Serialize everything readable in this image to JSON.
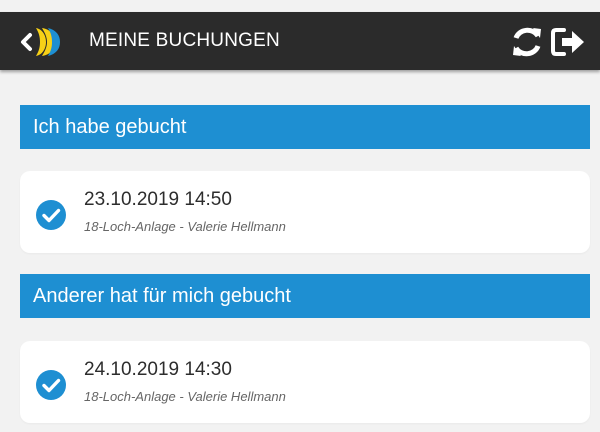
{
  "header": {
    "title": "MEINE BUCHUNGEN",
    "back_icon": "chevron-left-icon",
    "logo": "club-logo",
    "refresh_icon": "refresh-icon",
    "logout_icon": "sign-out-icon"
  },
  "sections": [
    {
      "title": "Ich habe gebucht",
      "bookings": [
        {
          "datetime": "23.10.2019 14:50",
          "detail": "18-Loch-Anlage - Valerie Hellmann",
          "status_icon": "check-circle-icon"
        }
      ]
    },
    {
      "title": "Anderer hat für mich gebucht",
      "bookings": [
        {
          "datetime": "24.10.2019 14:30",
          "detail": "18-Loch-Anlage - Valerie Hellmann",
          "status_icon": "check-circle-icon"
        }
      ]
    }
  ],
  "colors": {
    "header_bg": "#2b2b2b",
    "section_blue": "#1e8fd2",
    "logo_yellow": "#f7d117",
    "check_blue": "#1e8fd2",
    "page_bg": "#f2f2f2"
  }
}
